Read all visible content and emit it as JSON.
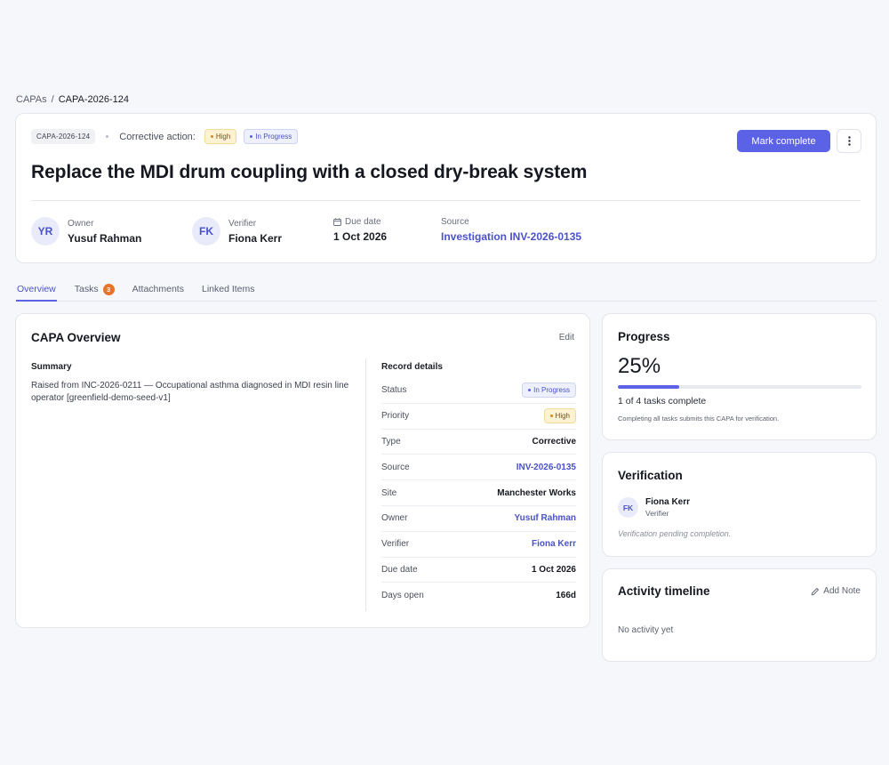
{
  "breadcrumb": {
    "root": "CAPAs",
    "separator": "/",
    "current": "CAPA-2026-124"
  },
  "header": {
    "id_chip": "CAPA-2026-124",
    "meta_label": "Corrective action:",
    "priority_badge": "High",
    "status_badge": "In Progress",
    "primary_button": "Mark complete",
    "title": "Replace the MDI drum coupling with a closed dry-break system",
    "owner": {
      "label": "Owner",
      "initials": "YR",
      "name": "Yusuf Rahman"
    },
    "verifier": {
      "label": "Verifier",
      "initials": "FK",
      "name": "Fiona Kerr"
    },
    "due_date": {
      "label": "Due date",
      "value": "1 Oct 2026"
    },
    "source": {
      "label": "Source",
      "value": "Investigation INV-2026-0135"
    }
  },
  "tabs": [
    {
      "label": "Overview",
      "active": true
    },
    {
      "label": "Tasks",
      "badge": "3"
    },
    {
      "label": "Attachments"
    },
    {
      "label": "Linked Items"
    }
  ],
  "overview": {
    "title": "CAPA Overview",
    "edit_label": "Edit",
    "summary_heading": "Summary",
    "summary_text": "Raised from INC-2026-0211 — Occupational asthma diagnosed in MDI resin line operator [greenfield-demo-seed-v1]",
    "record_heading": "Record details",
    "records": [
      {
        "label": "Status",
        "value": "In Progress"
      },
      {
        "label": "Priority",
        "value": "High"
      },
      {
        "label": "Type",
        "value": "Corrective"
      },
      {
        "label": "Source",
        "value": "INV-2026-0135"
      },
      {
        "label": "Site",
        "value": "Manchester Works"
      },
      {
        "label": "Owner",
        "value": "Yusuf Rahman"
      },
      {
        "label": "Verifier",
        "value": "Fiona Kerr"
      },
      {
        "label": "Due date",
        "value": "1 Oct 2026"
      },
      {
        "label": "Days open",
        "value": "166d"
      }
    ]
  },
  "progress": {
    "title": "Progress",
    "percent_label": "25%",
    "fraction": 0.25,
    "count_text": "1 of 4 tasks complete",
    "note": "Completing all tasks submits this CAPA for verification."
  },
  "verification": {
    "title": "Verification",
    "initials": "FK",
    "name": "Fiona Kerr",
    "role": "Verifier",
    "pending": "Verification pending completion."
  },
  "activity": {
    "title": "Activity timeline",
    "add_note": "Add Note",
    "empty": "No activity yet"
  },
  "colors": {
    "accent": "#5b62e6",
    "high": "#fdf3d3",
    "in_progress": "#eef0fd",
    "tab_badge": "#e7732a"
  }
}
